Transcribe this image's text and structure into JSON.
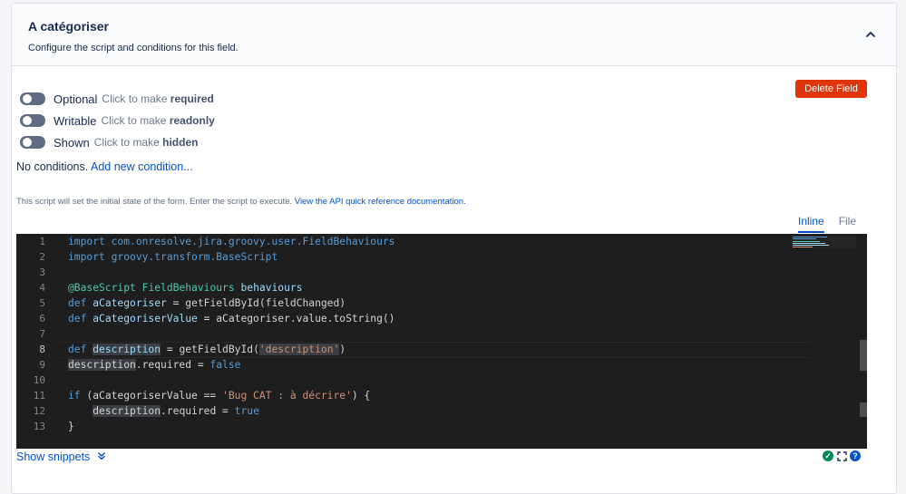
{
  "header": {
    "title": "A catégoriser",
    "subtitle": "Configure the script and conditions for this field."
  },
  "toggles": [
    {
      "name": "Optional",
      "hint_prefix": "Click to make",
      "hint_bold": "required"
    },
    {
      "name": "Writable",
      "hint_prefix": "Click to make",
      "hint_bold": "readonly"
    },
    {
      "name": "Shown",
      "hint_prefix": "Click to make",
      "hint_bold": "hidden"
    }
  ],
  "delete_label": "Delete Field",
  "conditions": {
    "text": "No conditions.",
    "link": "Add new condition..."
  },
  "script": {
    "description": "This script will set the initial state of the form. Enter the script to execute.",
    "doc_link": "View the API quick reference documentation."
  },
  "tabs": [
    {
      "label": "Inline",
      "active": true
    },
    {
      "label": "File",
      "active": false
    }
  ],
  "editor": {
    "line_numbers": [
      "1",
      "2",
      "3",
      "4",
      "5",
      "6",
      "7",
      "8",
      "9",
      "10",
      "11",
      "12",
      "13"
    ],
    "current_line": "8"
  },
  "show_snippets": "Show snippets",
  "colors": {
    "accent": "#0052cc",
    "danger": "#de350b",
    "editor_bg": "#1e1e1e",
    "status_ok": "#00875a"
  },
  "icons": [
    "chevron-up-icon",
    "double-chevron-down-icon",
    "check-circle-icon",
    "fullscreen-icon",
    "help-icon"
  ]
}
